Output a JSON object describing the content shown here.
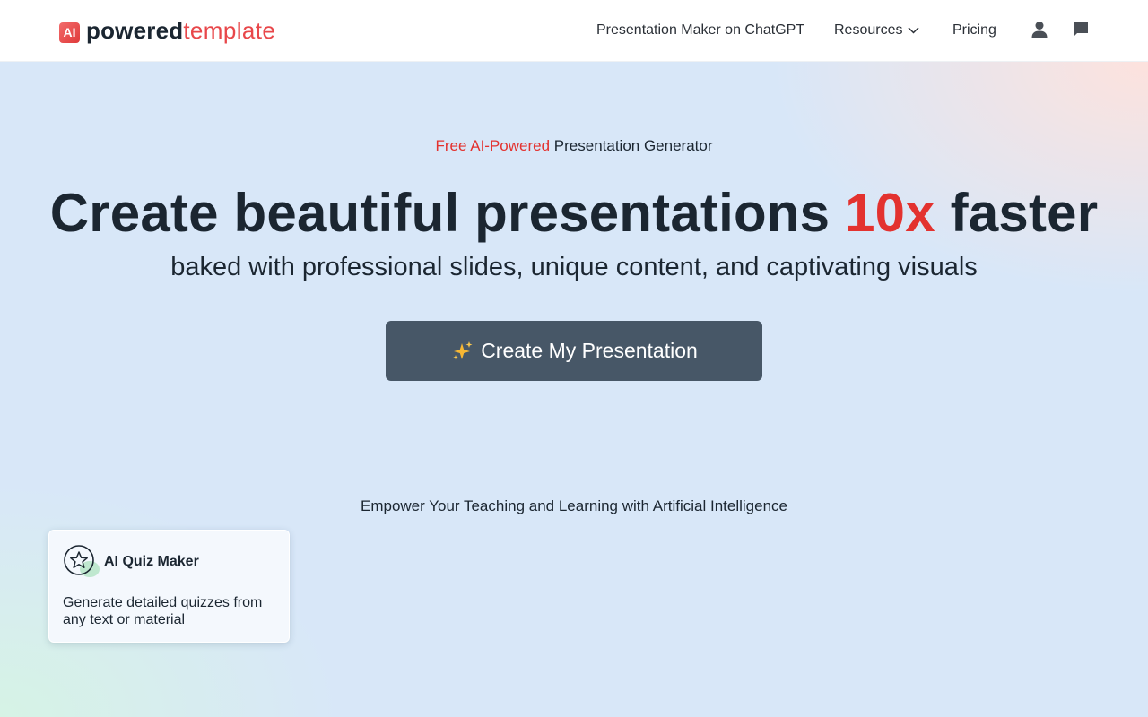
{
  "header": {
    "logo_badge": "AI",
    "logo_bold": "powered",
    "logo_light": "template",
    "nav": {
      "chatgpt": "Presentation Maker on ChatGPT",
      "resources": "Resources",
      "pricing": "Pricing"
    },
    "icons": [
      "user-icon",
      "chat-icon",
      "chevron-down-icon"
    ]
  },
  "hero": {
    "eyebrow_accent": "Free AI-Powered",
    "eyebrow_rest": "Presentation Generator",
    "headline_start": "Create beautiful presentations ",
    "headline_accent": "10x",
    "headline_end": " faster",
    "subhead": "baked with professional slides, unique content, and captivating visuals",
    "cta_label": "Create My Presentation",
    "cta_icon": "sparkles-icon",
    "tagline": "Empower Your Teaching and Learning with Artificial Intelligence"
  },
  "cards": [
    {
      "title": "AI Quiz Maker",
      "description": "Generate detailed quizzes from any text or material",
      "icon": "star-badge-icon"
    }
  ],
  "colors": {
    "accent": "#e3322f",
    "cta_bg": "#475767",
    "text": "#1b2631",
    "hero_bg": "#d8e7f8"
  }
}
